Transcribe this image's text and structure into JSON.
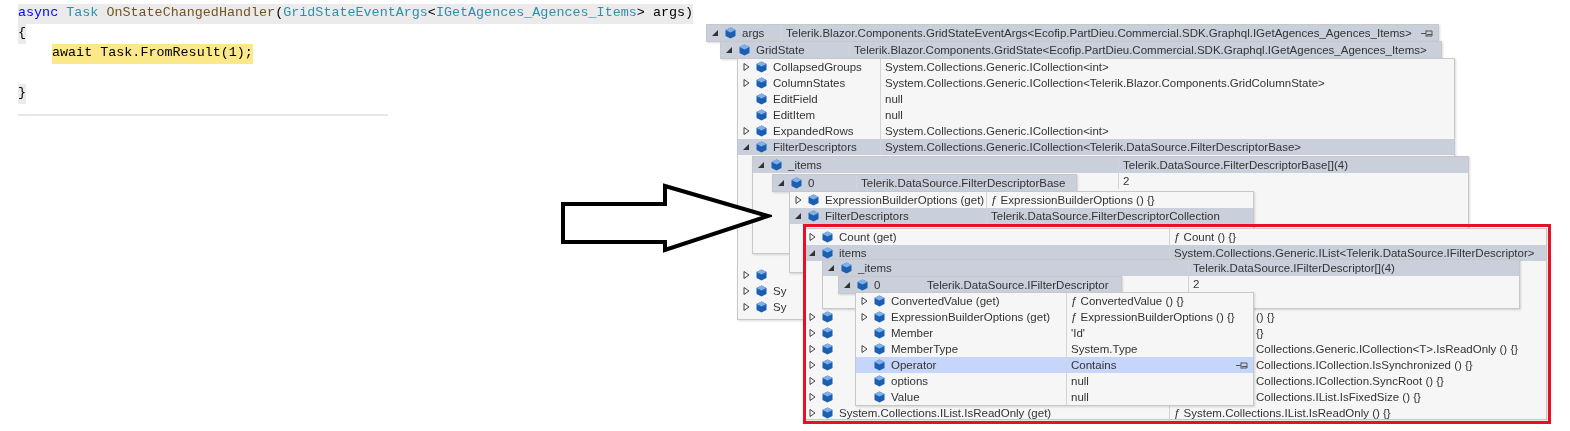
{
  "code": {
    "lines": [
      {
        "shaded": true,
        "highlighted": false,
        "tokens": [
          {
            "text": "async ",
            "kind": "keyword"
          },
          {
            "text": "Task ",
            "kind": "type"
          },
          {
            "text": "OnStateChangedHandler",
            "kind": "method"
          },
          {
            "text": "(",
            "kind": "plain"
          },
          {
            "text": "GridStateEventArgs",
            "kind": "type"
          },
          {
            "text": "<",
            "kind": "plain"
          },
          {
            "text": "IGetAgences_Agences_Items",
            "kind": "type"
          },
          {
            "text": "> args)",
            "kind": "plain"
          }
        ]
      },
      {
        "shaded": true,
        "highlighted": false,
        "tokens": [
          {
            "text": "{",
            "kind": "plain"
          }
        ],
        "children": [
          {
            "highlighted": true,
            "tokens": [
              {
                "text": "await Task.FromResult(1);",
                "kind": "plain"
              }
            ]
          }
        ]
      },
      {
        "shaded": true,
        "highlighted": false,
        "tokens": [
          {
            "text": "}",
            "kind": "plain"
          }
        ]
      }
    ]
  },
  "panels": [
    {
      "rows": [
        {
          "kind": "member",
          "expandable": true,
          "expanded": true,
          "name": "args",
          "value": "Telerik.Blazor.Components.GridStateEventArgs<Ecofip.PartDieu.Commercial.SDK.Graphql.IGetAgences_Agences_Items>",
          "selected": true,
          "pinned": true
        }
      ]
    },
    {
      "rows": [
        {
          "kind": "member",
          "expandable": true,
          "expanded": true,
          "name": "GridState",
          "value": "Telerik.Blazor.Components.GridState<Ecofip.PartDieu.Commercial.SDK.Graphql.IGetAgences_Agences_Items>",
          "selected": true
        }
      ]
    },
    {
      "rows": [
        {
          "kind": "member",
          "expandable": true,
          "expanded": false,
          "name": "CollapsedGroups",
          "value": "System.Collections.Generic.ICollection<int>",
          "selected": false
        },
        {
          "kind": "member",
          "expandable": true,
          "expanded": false,
          "name": "ColumnStates",
          "value": "System.Collections.Generic.ICollection<Telerik.Blazor.Components.GridColumnState>",
          "selected": false
        },
        {
          "kind": "member",
          "expandable": false,
          "name": "EditField",
          "value": "null",
          "selected": false
        },
        {
          "kind": "member",
          "expandable": false,
          "name": "EditItem",
          "value": "null",
          "selected": false
        },
        {
          "kind": "member",
          "expandable": true,
          "expanded": false,
          "name": "ExpandedRows",
          "value": "System.Collections.Generic.ICollection<int>",
          "selected": false
        },
        {
          "kind": "member",
          "expandable": true,
          "expanded": true,
          "name": "FilterDescriptors",
          "value": "System.Collections.Generic.ICollection<Telerik.DataSource.FilterDescriptorBase>",
          "selected": true
        },
        {
          "kind": "member",
          "expandable": true,
          "expanded": false,
          "selected": false
        },
        {
          "kind": "member",
          "expandable": true,
          "expanded": false,
          "name": "Sy",
          "selected": false
        },
        {
          "kind": "member",
          "expandable": true,
          "expanded": false,
          "name": "Sy",
          "selected": false
        }
      ]
    },
    {
      "rows": [
        {
          "kind": "member",
          "expandable": true,
          "expanded": true,
          "name": "_items",
          "value": "Telerik.DataSource.FilterDescriptorBase[](4)",
          "selected": true
        },
        {
          "kind": "value",
          "expandable": false,
          "value": "2",
          "selected": false
        }
      ]
    },
    {
      "rows": [
        {
          "kind": "member",
          "expandable": true,
          "expanded": true,
          "name": "0",
          "value": "Telerik.DataSource.FilterDescriptorBase",
          "selected": true
        }
      ]
    },
    {
      "rows": [
        {
          "kind": "member",
          "expandable": true,
          "expanded": false,
          "name": "ExpressionBuilderOptions (get)",
          "value": "ƒ ExpressionBuilderOptions () {}",
          "selected": false
        },
        {
          "kind": "member",
          "expandable": true,
          "expanded": true,
          "name": "FilterDescriptors",
          "value": "Telerik.DataSource.FilterDescriptorCollection",
          "selected": true
        }
      ]
    },
    {
      "rows": [
        {
          "kind": "member",
          "expandable": true,
          "expanded": false,
          "name": "Count (get)",
          "value": "ƒ Count () {}",
          "selected": false
        },
        {
          "kind": "member",
          "expandable": true,
          "expanded": true,
          "name": "items",
          "value": "System.Collections.Generic.IList<Telerik.DataSource.IFilterDescriptor>",
          "selected": true
        },
        {
          "kind": "member",
          "expandable": true,
          "expanded": false,
          "value": "() {}",
          "selected": false
        },
        {
          "kind": "member",
          "expandable": true,
          "expanded": false,
          "value": "{}",
          "selected": false
        },
        {
          "kind": "member",
          "expandable": true,
          "expanded": false,
          "value": "Collections.Generic.ICollection<T>.IsReadOnly () {}",
          "selected": false
        },
        {
          "kind": "member",
          "expandable": true,
          "expanded": false,
          "value": "Collections.ICollection.IsSynchronized () {}",
          "selected": false
        },
        {
          "kind": "member",
          "expandable": true,
          "expanded": false,
          "value": "Collections.ICollection.SyncRoot () {}",
          "selected": false
        },
        {
          "kind": "member",
          "expandable": true,
          "expanded": false,
          "value": "Collections.IList.IsFixedSize () {}",
          "selected": false
        },
        {
          "kind": "member",
          "expandable": true,
          "expanded": false,
          "name": "System.Collections.IList.IsReadOnly (get)",
          "value": "ƒ System.Collections.IList.IsReadOnly () {}",
          "selected": false
        }
      ]
    },
    {
      "rows": [
        {
          "kind": "member",
          "expandable": true,
          "expanded": true,
          "name": "_items",
          "value": "Telerik.DataSource.IFilterDescriptor[](4)",
          "selected": true
        },
        {
          "kind": "value",
          "expandable": false,
          "value": "2",
          "selected": false
        }
      ]
    },
    {
      "rows": [
        {
          "kind": "member",
          "expandable": true,
          "expanded": true,
          "name": "0",
          "value": "Telerik.DataSource.IFilterDescriptor",
          "selected": true
        }
      ]
    },
    {
      "rows": [
        {
          "kind": "member",
          "expandable": true,
          "expanded": false,
          "name": "ConvertedValue (get)",
          "value": "ƒ ConvertedValue () {}",
          "selected": false
        },
        {
          "kind": "member",
          "expandable": true,
          "expanded": false,
          "name": "ExpressionBuilderOptions (get)",
          "value": "ƒ ExpressionBuilderOptions () {}",
          "selected": false
        },
        {
          "kind": "member",
          "expandable": false,
          "name": "Member",
          "value": "'Id'",
          "selected": false
        },
        {
          "kind": "member",
          "expandable": true,
          "expanded": false,
          "name": "MemberType",
          "value": "System.Type",
          "selected": false
        },
        {
          "kind": "member",
          "expandable": false,
          "name": "Operator",
          "value": "Contains",
          "selected": true,
          "pinned": true
        },
        {
          "kind": "member",
          "expandable": false,
          "name": "options",
          "value": "null",
          "selected": false
        },
        {
          "kind": "member",
          "expandable": false,
          "name": "Value",
          "value": "null",
          "selected": false
        }
      ]
    }
  ]
}
